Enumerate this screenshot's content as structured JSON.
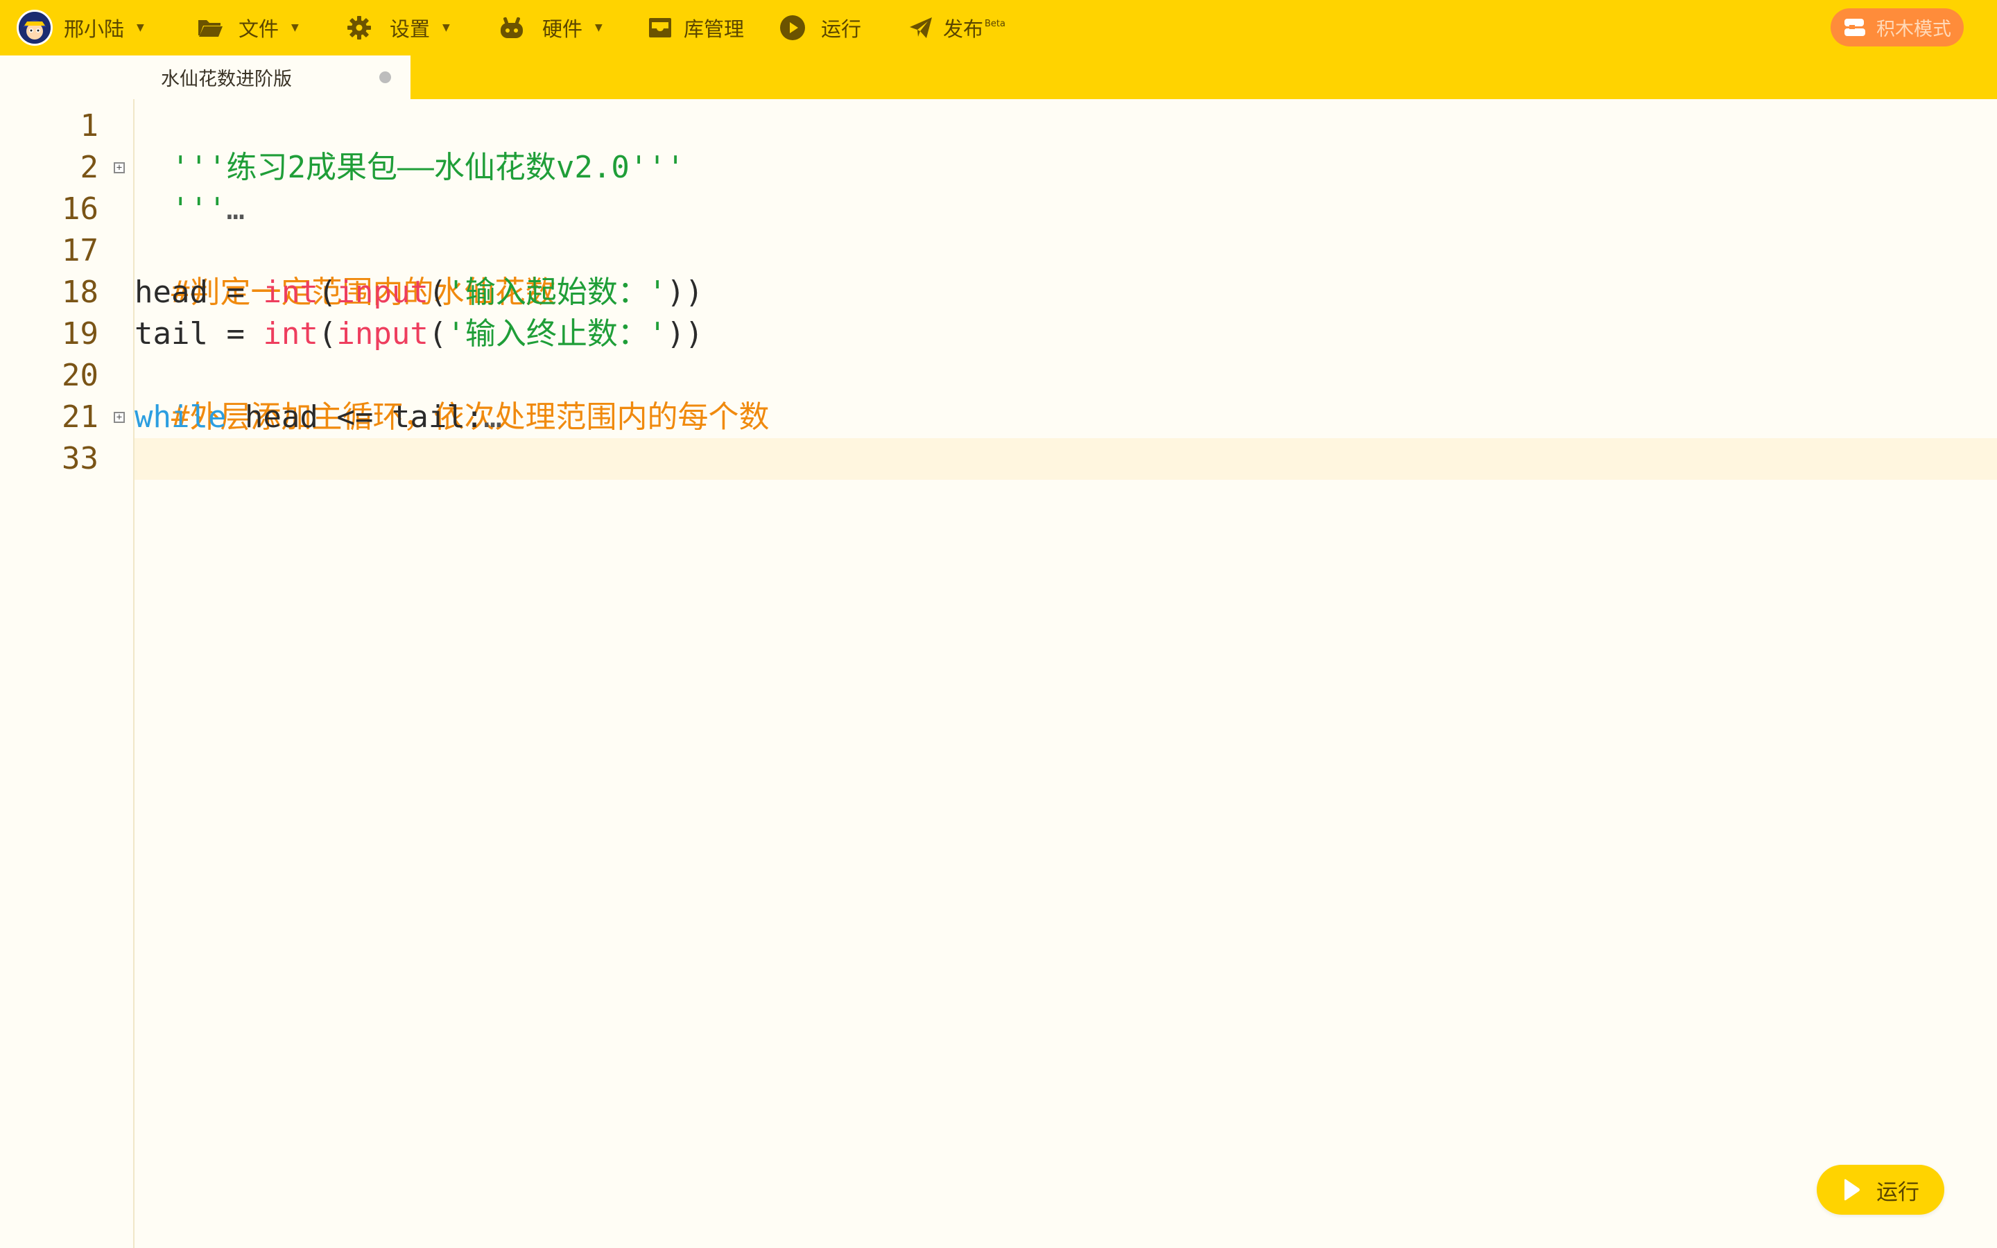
{
  "toolbar": {
    "user_name": "邢小陆",
    "file_label": "文件",
    "settings_label": "设置",
    "hardware_label": "硬件",
    "library_label": "库管理",
    "run_label": "运行",
    "publish_label": "发布",
    "publish_badge": "Beta",
    "blocks_mode_label": "积木模式"
  },
  "tab": {
    "title": "水仙花数进阶版"
  },
  "editor": {
    "line_numbers": [
      "1",
      "2",
      "16",
      "17",
      "18",
      "19",
      "20",
      "21",
      "33"
    ],
    "lines": {
      "l1": "'''练习2成果包——水仙花数v2.0'''",
      "l2_quote": "'''",
      "l2_ellipsis": "…",
      "l17": "#判定一定范围内的水仙花数",
      "l18_a": "head = ",
      "l18_int": "int",
      "l18_paren1": "(",
      "l18_input": "input",
      "l18_paren2": "(",
      "l18_str": "'输入起始数：'",
      "l18_close": "))",
      "l19_a": "tail = ",
      "l19_int": "int",
      "l19_paren1": "(",
      "l19_input": "input",
      "l19_paren2": "(",
      "l19_str": "'输入终止数：'",
      "l19_close": "))",
      "l20": "#外层添加主循环，依次处理范围内的每个数",
      "l21_kw": "while",
      "l21_rest": " head <= tail:",
      "l21_ellipsis": "…"
    }
  },
  "run_button": {
    "label": "运行"
  },
  "colors": {
    "toolbar_bg": "#ffd300",
    "editor_bg": "#fffdf5",
    "string": "#1f9e38",
    "comment": "#f08a0e",
    "builtin": "#ee3e5e",
    "keyword": "#2c9ee0",
    "line_number": "#7a5416",
    "blocks_button": "#ff8c3a"
  }
}
